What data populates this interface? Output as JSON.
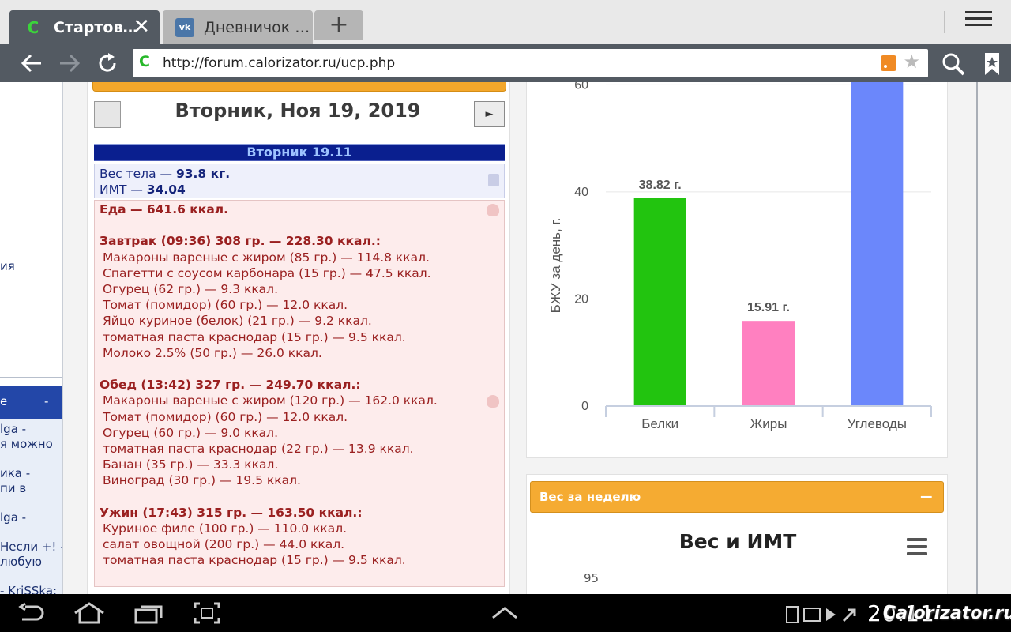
{
  "tabs": [
    {
      "favicon": "C",
      "title": "Стартов…",
      "active": true,
      "close": "✕"
    },
    {
      "favicon": "vk",
      "title": "Дневничок …",
      "active": false
    }
  ],
  "new_tab_label": "+",
  "address": {
    "url": "http://forum.calorizator.ru/ucp.php"
  },
  "sidebar": {
    "text_lines": [
      "ия",
      "lga -",
      "я можно",
      "ика -",
      "пи в",
      "lga -",
      "Несли +! -",
      "любую",
      "- KriSSka:"
    ],
    "blue_label": "е",
    "blue_collapse": "-"
  },
  "calendar": {
    "date_heading": "Вторник, Ноя 19, 2019",
    "next_label": "►",
    "day_header": "Вторник 19.11",
    "weight_label": "Вес тела — ",
    "weight_value": "93.8 кг.",
    "bmi_label": "ИМТ — ",
    "bmi_value": "34.04",
    "food_rows": [
      {
        "kind": "total",
        "text": "Еда — 641.6 ккал."
      },
      {
        "kind": "gap",
        "text": ""
      },
      {
        "kind": "meal",
        "text": "Завтрак (09:36) 308 гр. — 228.30 ккал.:"
      },
      {
        "kind": "item",
        "text": "Макароны вареные с жиром (85 гр.) — 114.8 ккал."
      },
      {
        "kind": "item",
        "text": "Спагетти с соусом карбонара (15 гр.) — 47.5 ккал."
      },
      {
        "kind": "item",
        "text": "Огурец (62 гр.) — 9.3 ккал."
      },
      {
        "kind": "item",
        "text": "Томат (помидор) (60 гр.) — 12.0 ккал."
      },
      {
        "kind": "item",
        "text": "Яйцо куриное (белок) (21 гр.) — 9.2 ккал."
      },
      {
        "kind": "item",
        "text": "томатная паста краснодар (15 гр.) — 9.5 ккал."
      },
      {
        "kind": "item",
        "text": "Молоко 2.5% (50 гр.) — 26.0 ккал."
      },
      {
        "kind": "gap",
        "text": ""
      },
      {
        "kind": "meal",
        "text": "Обед (13:42) 327 гр. — 249.70 ккал.:"
      },
      {
        "kind": "item",
        "text": "Макароны вареные с жиром (120 гр.) — 162.0 ккал."
      },
      {
        "kind": "item",
        "text": "Томат (помидор) (60 гр.) — 12.0 ккал."
      },
      {
        "kind": "item",
        "text": "Огурец (60 гр.) — 9.0 ккал."
      },
      {
        "kind": "item",
        "text": "томатная паста краснодар (22 гр.) — 13.9 ккал."
      },
      {
        "kind": "item",
        "text": "Банан (35 гр.) — 33.3 ккал."
      },
      {
        "kind": "item",
        "text": "Виноград (30 гр.) — 19.5 ккал."
      },
      {
        "kind": "gap",
        "text": ""
      },
      {
        "kind": "meal",
        "text": "Ужин (17:43) 315 гр. — 163.50 ккал.:"
      },
      {
        "kind": "item",
        "text": "Куриное филе (100 гр.) — 110.0 ккал."
      },
      {
        "kind": "item",
        "text": "салат овощной (200 гр.) — 44.0 ккал."
      },
      {
        "kind": "item",
        "text": "томатная паста краснодар (15 гр.) — 9.5 ккал."
      }
    ]
  },
  "chart_data": {
    "type": "bar",
    "ylabel": "БЖУ за день, г.",
    "categories": [
      "Белки",
      "Жиры",
      "Углеводы"
    ],
    "values": [
      38.82,
      15.91,
      67
    ],
    "data_labels": [
      "38.82 г.",
      "15.91 г.",
      ""
    ],
    "colors": [
      "#22c40f",
      "#ff80c0",
      "#6b87fb"
    ],
    "yticks": [
      0,
      20,
      40,
      60
    ],
    "ylim": [
      0,
      60.5
    ],
    "grid": true
  },
  "weekly": {
    "title": "Вес за неделю",
    "collapse": "−",
    "chart_title": "Вес и ИМТ",
    "first_tick": "95"
  },
  "system": {
    "clock": "20:11",
    "watermark": "Calorizator.ru"
  }
}
